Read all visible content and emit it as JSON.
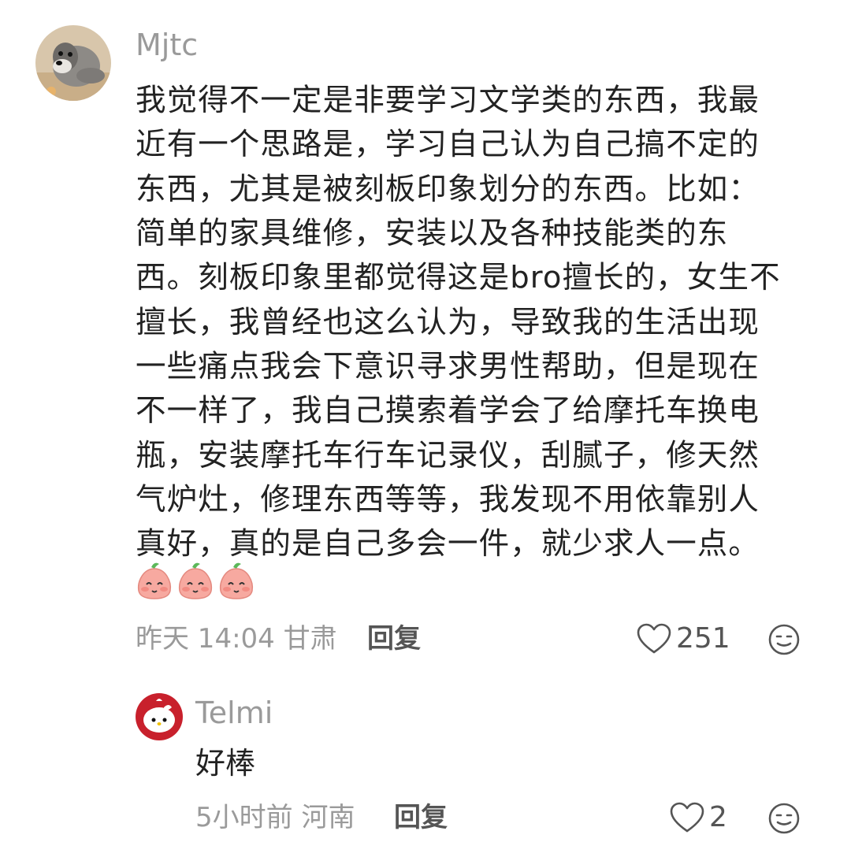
{
  "comment": {
    "username": "Mjtc",
    "lines": [
      "我觉得不一定是非要学习文学类的东西，我最",
      "近有一个思路是，学习自己认为自己搞不定的",
      "东西，尤其是被刻板印象划分的东西。比如：",
      "简单的家具维修，安装以及各种技能类的东",
      "西。刻板印象里都觉得这是bro擅长的，女生不",
      "擅长，我曾经也这么认为，导致我的生活出现",
      "一些痛点我会下意识寻求男性帮助，但是现在",
      "不一样了，我自己摸索着学会了给摩托车换电",
      "瓶，安装摩托车行车记录仪，刮腻子，修天然",
      "气炉灶，修理东西等等，我发现不用依靠别人",
      "真好，真的是自己多会一件，就少求人一点。"
    ],
    "emoji_count": 3,
    "time": "昨天 14:04",
    "location": "甘肃",
    "reply_label": "回复",
    "likes": "251"
  },
  "reply": {
    "username": "Telmi",
    "text": "好棒",
    "time": "5小时前",
    "location": "河南",
    "reply_label": "回复",
    "likes": "2"
  },
  "icons": {
    "like": "heart-outline-icon",
    "emoji": "smiley-face-icon"
  }
}
